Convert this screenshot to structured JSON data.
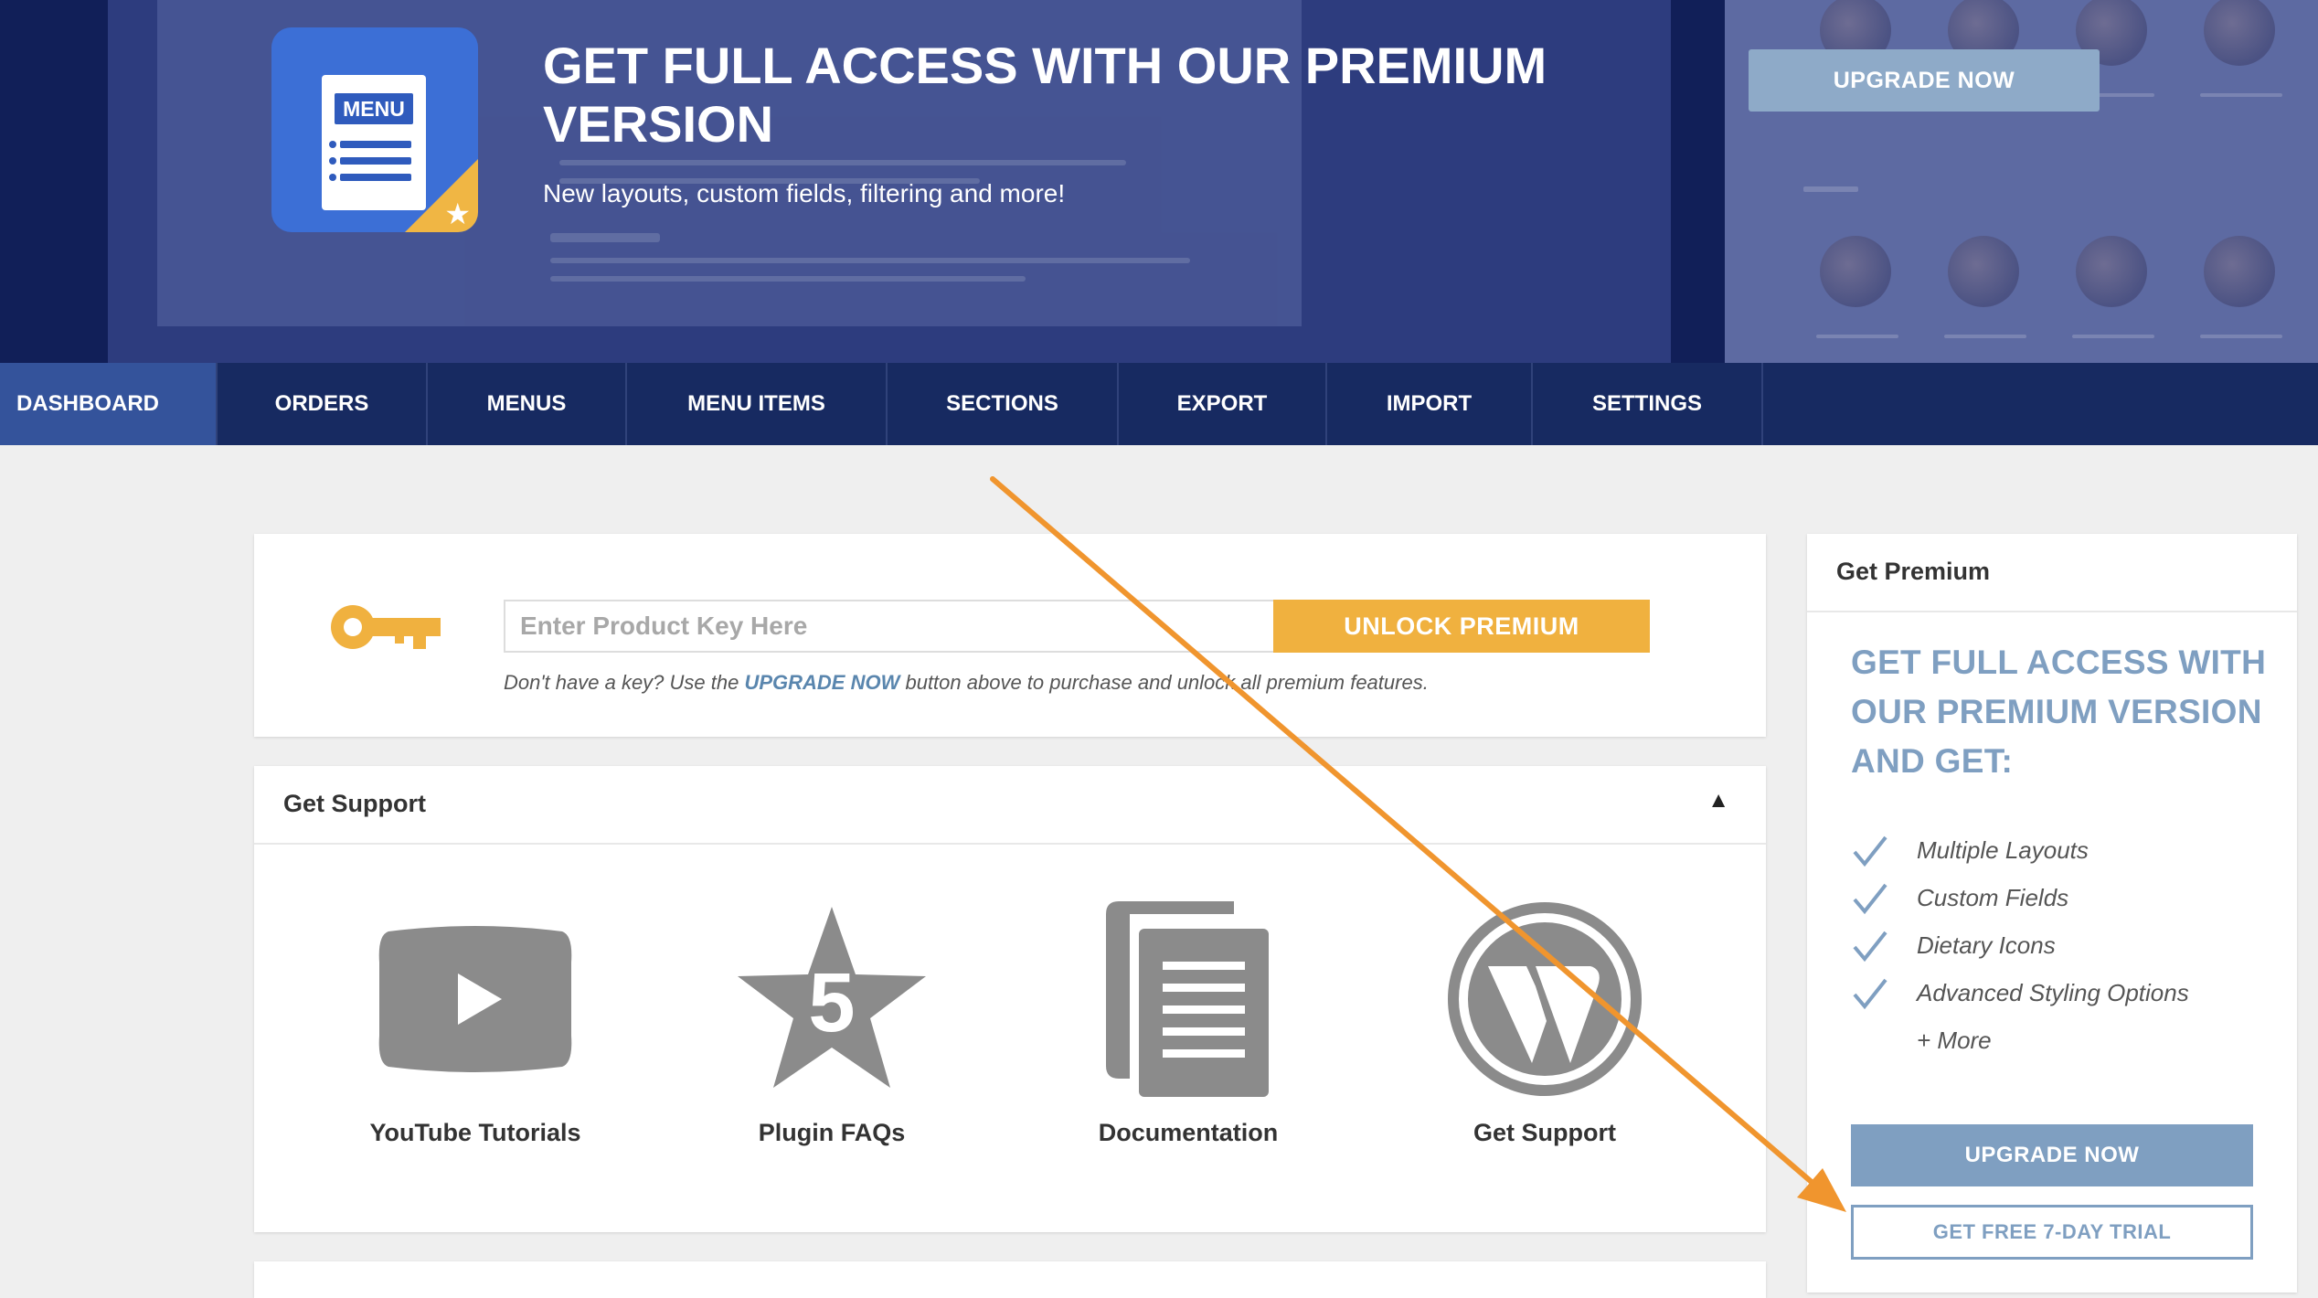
{
  "hero": {
    "title": "GET FULL ACCESS WITH OUR PREMIUM VERSION",
    "subtitle": "New layouts, custom fields, filtering and more!",
    "icon_label": "MENU",
    "upgrade_button": "UPGRADE NOW"
  },
  "nav": {
    "items": [
      {
        "label": "DASHBOARD",
        "active": true
      },
      {
        "label": "ORDERS"
      },
      {
        "label": "MENUS"
      },
      {
        "label": "MENU ITEMS"
      },
      {
        "label": "SECTIONS"
      },
      {
        "label": "EXPORT"
      },
      {
        "label": "IMPORT"
      },
      {
        "label": "SETTINGS"
      }
    ]
  },
  "license": {
    "placeholder": "Enter Product Key Here",
    "unlock_button": "UNLOCK PREMIUM",
    "note_before": "Don't have a key? Use the ",
    "note_link": "UPGRADE NOW",
    "note_after": " button above to purchase and unlock all premium features."
  },
  "support": {
    "title": "Get Support",
    "collapse_icon": "▲",
    "items": [
      {
        "label": "YouTube Tutorials",
        "icon": "youtube-icon"
      },
      {
        "label": "Plugin FAQs",
        "icon": "star-five-icon",
        "badge": "5"
      },
      {
        "label": "Documentation",
        "icon": "documents-icon"
      },
      {
        "label": "Get Support",
        "icon": "wordpress-icon"
      }
    ]
  },
  "premium": {
    "title": "Get Premium",
    "headline": "GET FULL ACCESS WITH OUR PREMIUM VERSION AND GET:",
    "features": [
      "Multiple Layouts",
      "Custom Fields",
      "Dietary Icons",
      "Advanced Styling Options"
    ],
    "more": "+ More",
    "upgrade_button": "UPGRADE NOW",
    "trial_button": "GET FREE 7-DAY TRIAL"
  },
  "colors": {
    "accent_gold": "#f0b13f",
    "premium_blue": "#7f9fc1",
    "nav_bg": "#172a61",
    "annotation_arrow": "#f0952e"
  }
}
